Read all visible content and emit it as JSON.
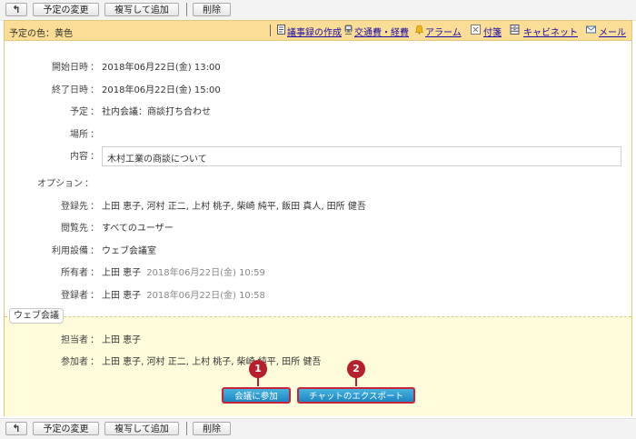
{
  "toolbar": {
    "back_icon": "back-arrow-icon",
    "change_label": "予定の変更",
    "copy_label": "複写して追加",
    "delete_label": "削除"
  },
  "header": {
    "color_label": "予定の色：黄色",
    "links": {
      "minutes": "議事録の作成",
      "expenses": "交通費・経費",
      "alarm": "アラーム",
      "note": "付箋",
      "cabinet": "キャビネット",
      "mail": "メール"
    }
  },
  "details": {
    "start_label": "開始日時",
    "start_value": "2018年06月22日(金) 13:00",
    "end_label": "終了日時",
    "end_value": "2018年06月22日(金) 15:00",
    "schedule_label": "予定",
    "schedule_value": "社内会議：商談打ち合わせ",
    "place_label": "場所",
    "place_value": "",
    "content_label": "内容",
    "content_value": "木村工業の商談について",
    "option_label": "オプション",
    "registrants_label": "登録先",
    "registrants_value": "上田 恵子, 河村 正二, 上村 桃子, 柴崎 純平, 飯田 真人, 田所 健吾",
    "viewers_label": "閲覧先",
    "viewers_value": "すべてのユーザー",
    "facility_label": "利用設備",
    "facility_value": "ウェブ会議室",
    "owner_label": "所有者",
    "owner_name": "上田 恵子",
    "owner_time": "2018年06月22日(金) 10:59",
    "registrar_label": "登録者",
    "registrar_name": "上田 恵子",
    "registrar_time": "2018年06月22日(金) 10:58"
  },
  "web_meeting": {
    "tag": "ウェブ会議",
    "host_label": "担当者",
    "host_value": "上田 恵子",
    "participants_label": "参加者",
    "participants_value": "上田 恵子, 河村 正二, 上村 桃子, 柴崎 純平, 田所 健吾",
    "join_button": "会議に参加",
    "export_button": "チャットのエクスポート",
    "callout_1": "1",
    "callout_2": "2"
  },
  "colors": {
    "header_bg": "#fbdd95",
    "web_area_bg": "#fffcdb",
    "button_blue": "#1d86c2",
    "callout_red": "#b61f2c",
    "link_blue": "#1a0dab"
  }
}
